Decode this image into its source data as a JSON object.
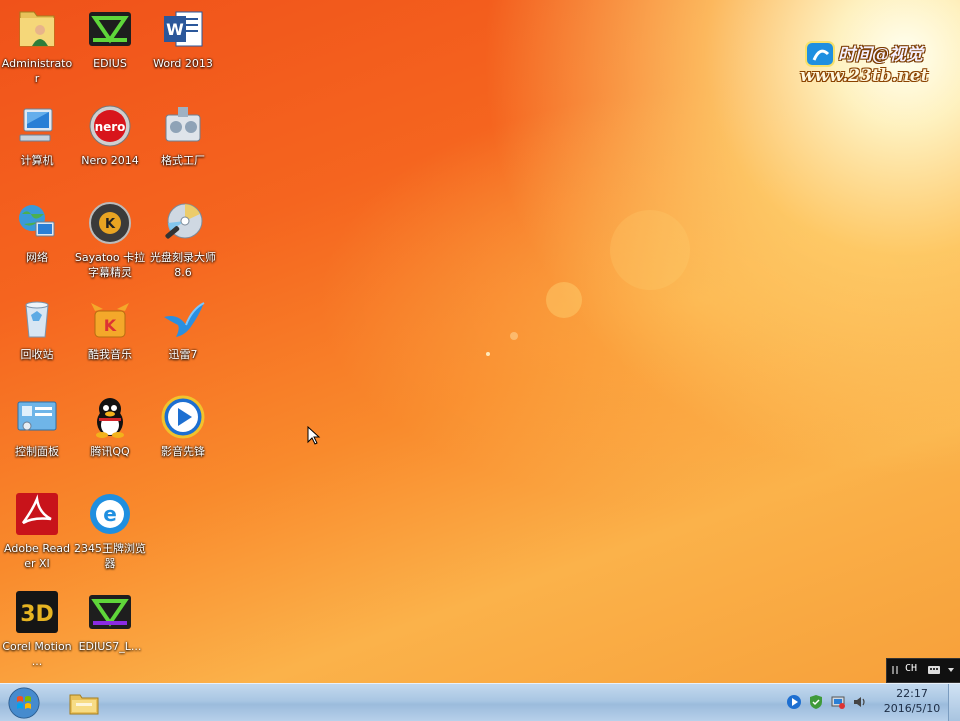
{
  "desktop": {
    "icons": [
      {
        "label": "Administrator",
        "icon": "user-folder-icon"
      },
      {
        "label": "EDIUS",
        "icon": "edius-icon"
      },
      {
        "label": "Word 2013",
        "icon": "word-icon"
      },
      {
        "label": "计算机",
        "icon": "computer-icon"
      },
      {
        "label": "Nero 2014",
        "icon": "nero-icon"
      },
      {
        "label": "格式工厂",
        "icon": "format-factory-icon"
      },
      {
        "label": "网络",
        "icon": "network-icon"
      },
      {
        "label": "Sayatoo 卡拉字幕精灵",
        "icon": "sayatoo-icon"
      },
      {
        "label": "光盘刻录大师8.6",
        "icon": "disc-burner-icon"
      },
      {
        "label": "回收站",
        "icon": "recycle-bin-icon"
      },
      {
        "label": "酷我音乐",
        "icon": "kuwo-music-icon"
      },
      {
        "label": "迅雷7",
        "icon": "thunder-icon"
      },
      {
        "label": "控制面板",
        "icon": "control-panel-icon"
      },
      {
        "label": "腾讯QQ",
        "icon": "qq-icon"
      },
      {
        "label": "影音先锋",
        "icon": "media-player-icon"
      },
      {
        "label": "Adobe Reader XI",
        "icon": "adobe-reader-icon"
      },
      {
        "label": "2345王牌浏览器",
        "icon": "browser-2345-icon"
      },
      {
        "label": "Corel Motion ...",
        "icon": "corel-motion-icon"
      },
      {
        "label": "EDIUS7_L...",
        "icon": "edius7-icon"
      }
    ],
    "watermark": {
      "line1": "时间@视觉",
      "line2": "www.23tb.net"
    }
  },
  "language_bar": {
    "lang": "CH"
  },
  "taskbar": {
    "start_icon": "windows-start-icon",
    "pinned": "file-explorer-icon",
    "clock": {
      "time": "22:17",
      "date": "2016/5/10"
    }
  }
}
